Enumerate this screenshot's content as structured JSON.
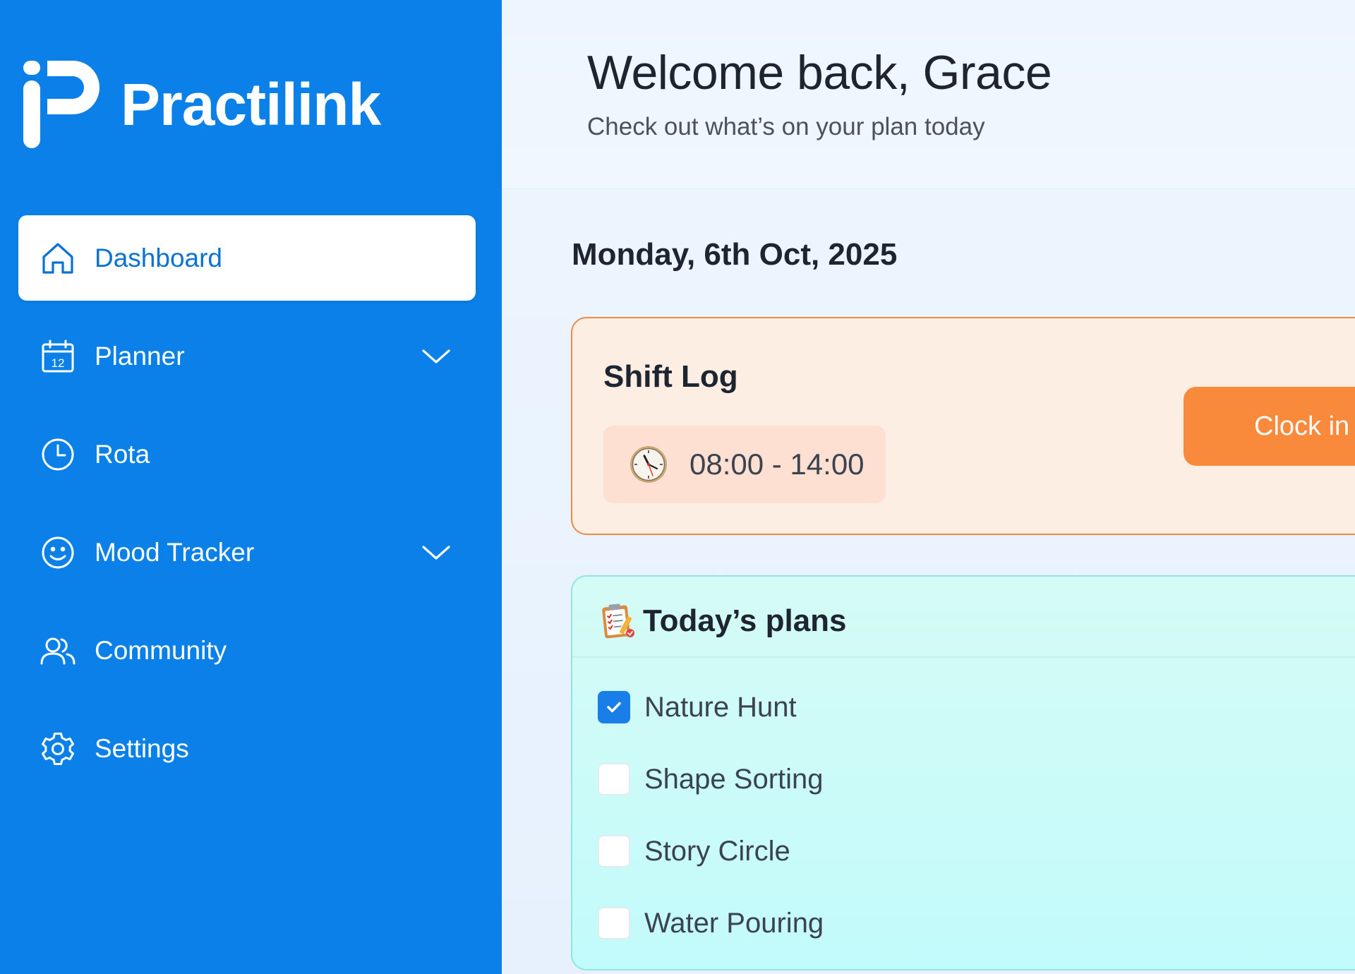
{
  "brand": {
    "name": "Practilink",
    "logo_icon": "practilink-logo"
  },
  "nav": {
    "items": [
      {
        "label": "Dashboard",
        "icon": "home-icon",
        "active": true
      },
      {
        "label": "Planner",
        "icon": "calendar-icon",
        "calendar_day": "12",
        "expandable": true
      },
      {
        "label": "Rota",
        "icon": "clock-icon"
      },
      {
        "label": "Mood Tracker",
        "icon": "smiley-icon",
        "expandable": true
      },
      {
        "label": "Community",
        "icon": "users-icon"
      },
      {
        "label": "Settings",
        "icon": "gear-icon"
      }
    ]
  },
  "header": {
    "welcome": "Welcome back, Grace",
    "subtitle": "Check out what’s on your plan today"
  },
  "date": "Monday, 6th Oct, 2025",
  "shift_log": {
    "title": "Shift Log",
    "time_range": "08:00 - 14:00",
    "clock_in_label": "Clock in",
    "icon": "wall-clock-icon"
  },
  "plans": {
    "title": "Today’s plans",
    "icon": "clipboard-icon",
    "items": [
      {
        "label": "Nature Hunt",
        "checked": true
      },
      {
        "label": "Shape Sorting",
        "checked": false
      },
      {
        "label": "Story Circle",
        "checked": false
      },
      {
        "label": "Water Pouring",
        "checked": false
      }
    ]
  },
  "colors": {
    "sidebar": "#0a80e8",
    "active_text": "#0a72d4",
    "shift_card_bg": "#fdeee3",
    "shift_card_border": "#ef8a43",
    "clock_button": "#f98a3c",
    "plans_card_bg": "#c8fbf8",
    "checkbox_checked": "#1a7ee8"
  }
}
